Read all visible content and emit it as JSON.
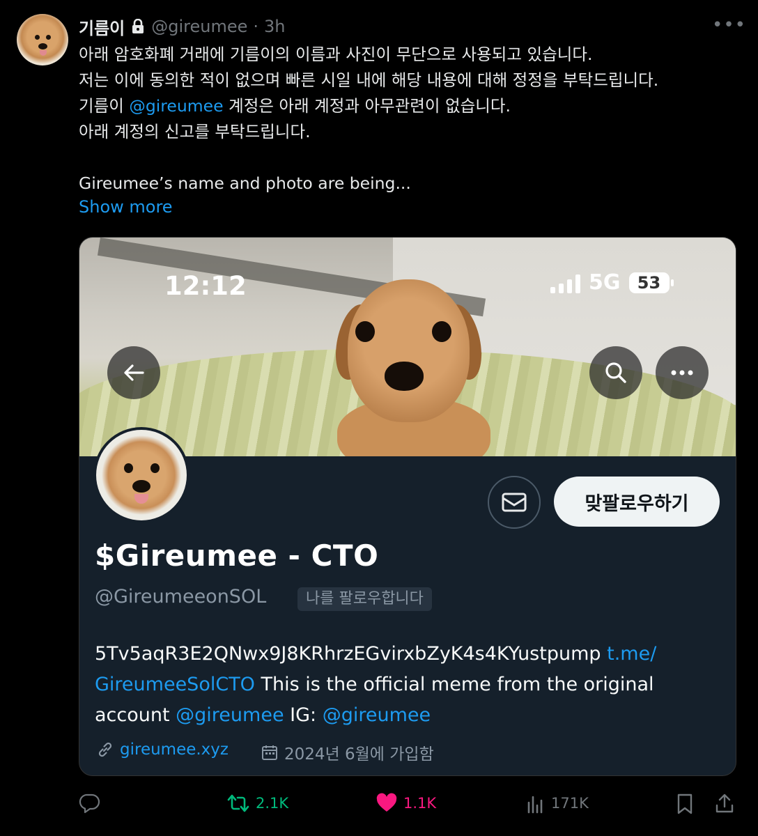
{
  "tweet": {
    "author_name": "기름이",
    "author_handle": "@gireumee",
    "separator": "·",
    "time": "3h",
    "body_lines": [
      "아래 암호화폐 거래에 기름이의 이름과 사진이 무단으로 사용되고 있습니다.",
      "저는 이에 동의한 적이 없으며 빠른 시일 내에 해당 내용에 대해 정정을 부탁드립니다."
    ],
    "line3_prefix": "기름이 ",
    "line3_link": "@gireumee",
    "line3_suffix": " 계정은 아래 계정과 아무관련이 없습니다.",
    "line4": "아래 계정의 신고를 부탁드립니다.",
    "english_line": "Gireumee’s name and photo are being...",
    "show_more": "Show more"
  },
  "embedded_profile": {
    "status_time": "12:12",
    "network": "5G",
    "battery": "53",
    "display_name": "$Gireumee - CTO",
    "handle": "@GireumeeonSOL",
    "follows_you_badge": "나를 팔로우합니다",
    "follow_back_label": "맞팔로우하기",
    "bio_line1_text": "5Tv5aqR3E2QNwx9J8KRhrzEGvirxbZyK4s4KYustpump ",
    "bio_line1_link": "t.me/",
    "bio_line2_link": "GireumeeSolCTO",
    "bio_line2_text": " This is the official meme from the original",
    "bio_line3_text1": "account ",
    "bio_line3_link1": "@gireumee",
    "bio_line3_text2": " IG: ",
    "bio_line3_link2": "@gireumee",
    "website": "gireumee.xyz",
    "joined": "2024년 6월에 가입함"
  },
  "actions": {
    "reposts": "2.1K",
    "likes": "1.1K",
    "views": "171K"
  },
  "colors": {
    "link": "#1d9bf0",
    "repost": "#00ba7c",
    "like": "#f91880",
    "muted": "#71767b"
  }
}
